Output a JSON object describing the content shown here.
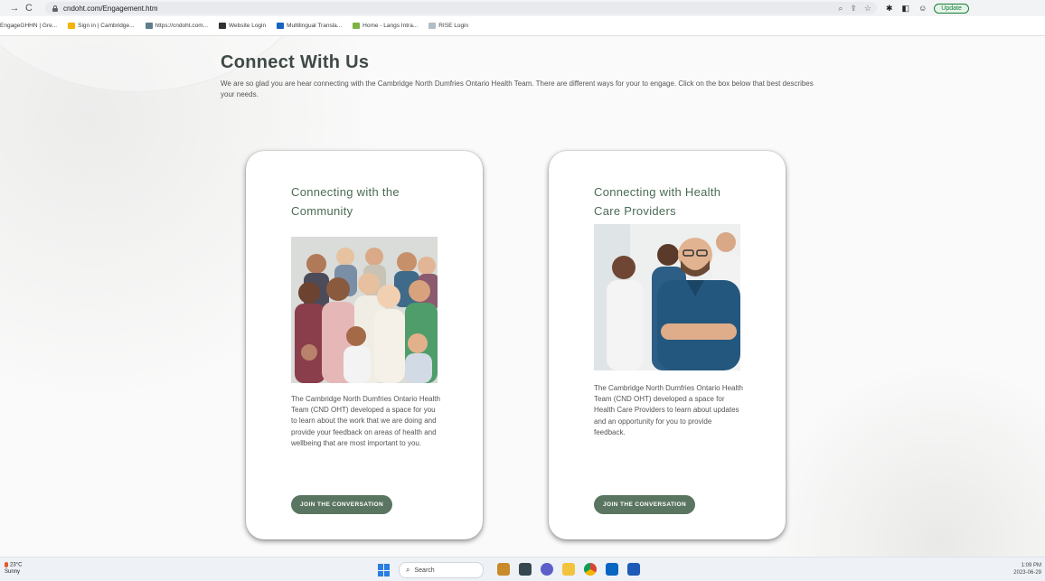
{
  "browser": {
    "url": "cndoht.com/Engagement.htm",
    "update_label": "Update",
    "bookmarks": [
      {
        "label": "EngageGHHN | Gre...",
        "color": "#9aa0a6"
      },
      {
        "label": "Sign in | Cambridge...",
        "color": "#f4b400"
      },
      {
        "label": "https://cndoht.com...",
        "color": "#607d8b"
      },
      {
        "label": "Website Login",
        "color": "#333333"
      },
      {
        "label": "Multilingual Transla...",
        "color": "#1565c0"
      },
      {
        "label": "Home - Langs Intra...",
        "color": "#7cb342"
      },
      {
        "label": "RISE Login",
        "color": "#b0bec5"
      }
    ]
  },
  "page": {
    "heading": "Connect With Us",
    "intro": "We are so glad you are hear connecting with the Cambridge North Dumfries Ontario Health Team. There are different ways for your to engage. Click on the box below that best describes your needs.",
    "cards": [
      {
        "title": "Connecting with the Community",
        "text": "The Cambridge North Dumfries Ontario Health Team (CND OHT) developed a space for you to learn about the work that we are doing and provide your feedback on areas of health and wellbeing that are most important to you.",
        "button": "JOIN THE CONVERSATION"
      },
      {
        "title": "Connecting with Health Care Providers",
        "text": "The Cambridge North Dumfries Ontario Health Team (CND OHT) developed a space for Health Care Providers to learn about updates and an opportunity for you to provide feedback.",
        "button": "JOIN THE CONVERSATION"
      }
    ]
  },
  "taskbar": {
    "temperature": "23°C",
    "weather": "Sunny",
    "search_placeholder": "Search",
    "time": "1:09 PM",
    "date": "2023-06-29"
  },
  "colors": {
    "accent": "#5a7561",
    "title": "#4a6b55"
  }
}
